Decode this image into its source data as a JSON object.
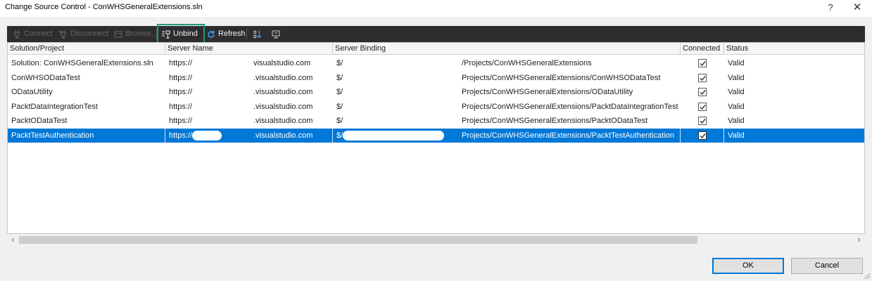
{
  "window": {
    "title": "Change Source Control - ConWHSGeneralExtensions.sln",
    "help_label": "?",
    "close_label": "✕"
  },
  "toolbar": {
    "connect_label": "Connect",
    "disconnect_label": "Disconnect",
    "browse_label": "Browse...",
    "unbind_label": "Unbind",
    "refresh_label": "Refresh"
  },
  "table": {
    "columns": [
      "Solution/Project",
      "Server Name",
      "Server Binding",
      "Connected",
      "Status"
    ],
    "rows": [
      {
        "project": "Solution: ConWHSGeneralExtensions.sln",
        "server_prefix": "https://",
        "server_suffix": "visualstudio.com",
        "binding_prefix": "$/",
        "binding_suffix": "/Projects/ConWHSGeneralExtensions",
        "connected": true,
        "status": "Valid",
        "selected": false
      },
      {
        "project": "ConWHSODataTest",
        "server_prefix": "https://",
        "server_suffix": ".visualstudio.com",
        "binding_prefix": "$/",
        "binding_suffix": "Projects/ConWHSGeneralExtensions/ConWHSODataTest",
        "connected": true,
        "status": "Valid",
        "selected": false
      },
      {
        "project": "ODataUtility",
        "server_prefix": "https://",
        "server_suffix": ".visualstudio.com",
        "binding_prefix": "$/",
        "binding_suffix": "Projects/ConWHSGeneralExtensions/ODataUtility",
        "connected": true,
        "status": "Valid",
        "selected": false
      },
      {
        "project": "PacktDataIntegrationTest",
        "server_prefix": "https://",
        "server_suffix": ".visualstudio.com",
        "binding_prefix": "$/",
        "binding_suffix": "Projects/ConWHSGeneralExtensions/PacktDataIntegrationTest",
        "connected": true,
        "status": "Valid",
        "selected": false
      },
      {
        "project": "PacktODataTest",
        "server_prefix": "https://",
        "server_suffix": ".visualstudio.com",
        "binding_prefix": "$/",
        "binding_suffix": "Projects/ConWHSGeneralExtensions/PacktODataTest",
        "connected": true,
        "status": "Valid",
        "selected": false
      },
      {
        "project": "PacktTestAuthentication",
        "server_prefix": "https://",
        "server_suffix": ".visualstudio.com",
        "binding_prefix": "$/",
        "binding_suffix": "Projects/ConWHSGeneralExtensions/PacktTestAuthentication",
        "connected": true,
        "status": "Valid",
        "selected": true
      }
    ]
  },
  "scroll": {
    "left": "‹",
    "right": "›"
  },
  "buttons": {
    "ok_label": "OK",
    "cancel_label": "Cancel"
  },
  "colors": {
    "toolbar_bg": "#2d2d30",
    "selection": "#0078d7",
    "highlight_box": "#1a9c76"
  }
}
